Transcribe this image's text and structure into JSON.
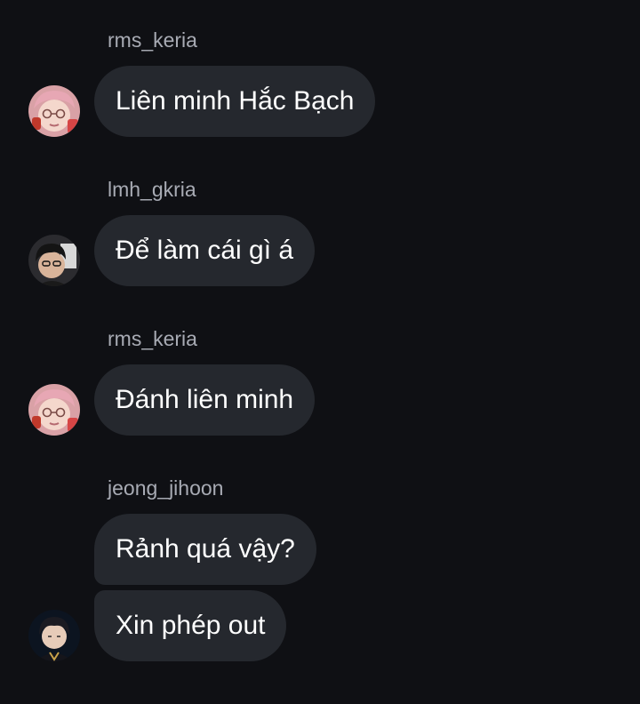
{
  "messages": [
    {
      "username": "rms_keria",
      "avatar": "avatar-pink-hair",
      "texts": [
        "Liên minh Hắc Bạch"
      ]
    },
    {
      "username": "lmh_gkria",
      "avatar": "avatar-dark-hair",
      "texts": [
        "Để làm cái gì á"
      ]
    },
    {
      "username": "rms_keria",
      "avatar": "avatar-pink-hair",
      "texts": [
        "Đánh liên minh"
      ]
    },
    {
      "username": "jeong_jihoon",
      "avatar": "avatar-dark-portrait",
      "texts": [
        "Rảnh quá vậy?",
        "Xin phép out"
      ]
    }
  ],
  "colors": {
    "background": "#0f1014",
    "bubble": "#25282e",
    "username": "#a8abb4",
    "message_text": "#ffffff"
  }
}
